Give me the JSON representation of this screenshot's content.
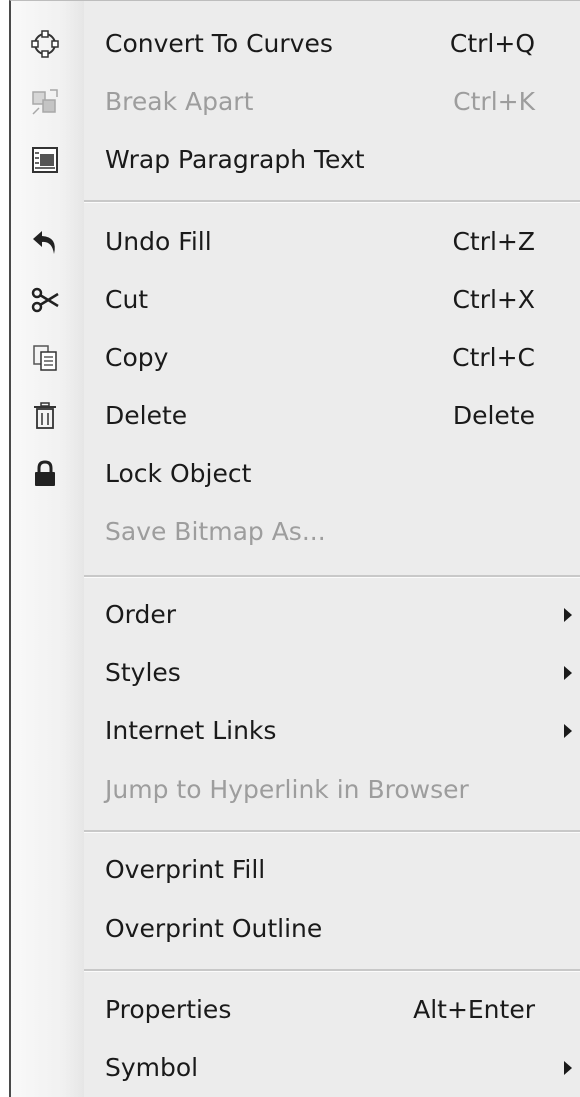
{
  "menu": {
    "items": [
      {
        "label": "Convert To Curves",
        "shortcut": "Ctrl+Q",
        "icon": "convert-to-curves-icon",
        "enabled": true
      },
      {
        "label": "Break Apart",
        "shortcut": "Ctrl+K",
        "icon": "break-apart-icon",
        "enabled": false
      },
      {
        "label": "Wrap Paragraph Text",
        "shortcut": "",
        "icon": "wrap-paragraph-icon",
        "enabled": true
      },
      {
        "label": "Undo Fill",
        "shortcut": "Ctrl+Z",
        "icon": "undo-icon",
        "enabled": true
      },
      {
        "label": "Cut",
        "shortcut": "Ctrl+X",
        "icon": "scissors-icon",
        "enabled": true
      },
      {
        "label": "Copy",
        "shortcut": "Ctrl+C",
        "icon": "copy-icon",
        "enabled": true
      },
      {
        "label": "Delete",
        "shortcut": "Delete",
        "icon": "trash-icon",
        "enabled": true
      },
      {
        "label": "Lock Object",
        "shortcut": "",
        "icon": "lock-icon",
        "enabled": true
      },
      {
        "label": "Save Bitmap As...",
        "shortcut": "",
        "icon": "",
        "enabled": false
      },
      {
        "label": "Order",
        "shortcut": "",
        "icon": "",
        "enabled": true,
        "submenu": true
      },
      {
        "label": "Styles",
        "shortcut": "",
        "icon": "",
        "enabled": true,
        "submenu": true
      },
      {
        "label": "Internet Links",
        "shortcut": "",
        "icon": "",
        "enabled": true,
        "submenu": true
      },
      {
        "label": "Jump to Hyperlink in Browser",
        "shortcut": "",
        "icon": "",
        "enabled": false
      },
      {
        "label": "Overprint Fill",
        "shortcut": "",
        "icon": "",
        "enabled": true
      },
      {
        "label": "Overprint Outline",
        "shortcut": "",
        "icon": "",
        "enabled": true
      },
      {
        "label": "Properties",
        "shortcut": "Alt+Enter",
        "icon": "",
        "enabled": true
      },
      {
        "label": "Symbol",
        "shortcut": "",
        "icon": "",
        "enabled": true,
        "submenu": true
      }
    ]
  }
}
